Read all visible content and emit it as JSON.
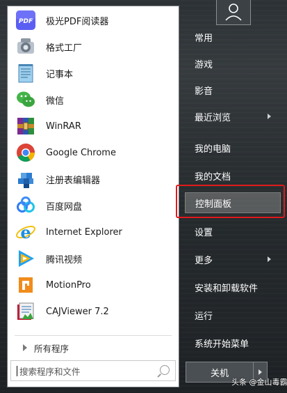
{
  "programs": [
    {
      "label": "极光PDF阅读器",
      "icon": "pdf-icon"
    },
    {
      "label": "格式工厂",
      "icon": "format-factory-icon"
    },
    {
      "label": "记事本",
      "icon": "notepad-icon"
    },
    {
      "label": "微信",
      "icon": "wechat-icon"
    },
    {
      "label": "WinRAR",
      "icon": "winrar-icon"
    },
    {
      "label": "Google Chrome",
      "icon": "chrome-icon"
    },
    {
      "label": "注册表编辑器",
      "icon": "regedit-icon"
    },
    {
      "label": "百度网盘",
      "icon": "baidu-netdisk-icon"
    },
    {
      "label": "Internet Explorer",
      "icon": "ie-icon"
    },
    {
      "label": "腾讯视频",
      "icon": "tencent-video-icon"
    },
    {
      "label": "MotionPro",
      "icon": "motionpro-icon"
    },
    {
      "label": "CAJViewer 7.2",
      "icon": "cajviewer-icon"
    }
  ],
  "all_programs_label": "所有程序",
  "search": {
    "placeholder": "搜索程序和文件"
  },
  "right_menu": [
    {
      "label": "常用",
      "arrow": false
    },
    {
      "label": "游戏",
      "arrow": false
    },
    {
      "label": "影音",
      "arrow": false
    },
    {
      "label": "最近浏览",
      "arrow": true
    },
    {
      "label": "我的电脑",
      "arrow": false
    },
    {
      "label": "我的文档",
      "arrow": false
    },
    {
      "label": "控制面板",
      "arrow": false
    },
    {
      "label": "设置",
      "arrow": false
    },
    {
      "label": "更多",
      "arrow": true
    },
    {
      "label": "安装和卸载软件",
      "arrow": false
    },
    {
      "label": "运行",
      "arrow": false
    },
    {
      "label": "系统开始菜单",
      "arrow": false
    }
  ],
  "shutdown_label": "关机",
  "watermark": "头条 @金山毒霸",
  "colors": {
    "highlight_border": "#e0191b"
  }
}
